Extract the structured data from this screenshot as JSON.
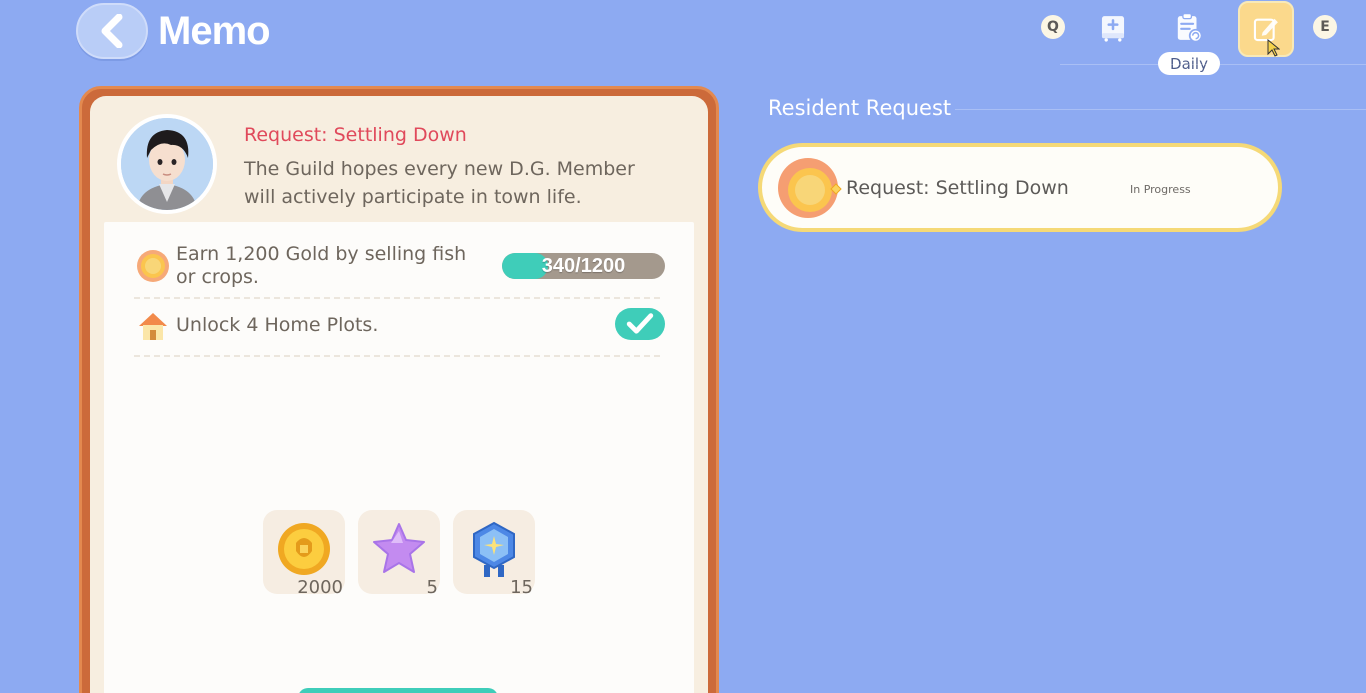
{
  "header": {
    "title": "Memo",
    "key_left": "Q",
    "key_right": "E",
    "tooltip": "Daily"
  },
  "memo": {
    "request_title": "Request: Settling Down",
    "description": "The Guild hopes every new D.G. Member will actively participate in town life.",
    "objectives": [
      {
        "text": "Earn 1,200 Gold by selling fish or crops.",
        "icon": "gold-coin-icon",
        "progress_text": "340/1200",
        "progress_fraction": 0.283
      },
      {
        "text": "Unlock 4 Home Plots.",
        "icon": "house-icon",
        "completed": true
      }
    ],
    "rewards": [
      {
        "icon": "gold-coin-icon",
        "count": "2000"
      },
      {
        "icon": "purple-star-icon",
        "count": "5"
      },
      {
        "icon": "blue-badge-icon",
        "count": "15"
      }
    ]
  },
  "resident": {
    "section_title": "Resident Request",
    "items": [
      {
        "label": "Request: Settling Down",
        "status": "In Progress",
        "icon": "gold-coin-icon"
      }
    ]
  },
  "colors": {
    "background": "#8daaf2",
    "frame": "#cc6a3a",
    "accent_teal": "#3fcdb9",
    "request_red": "#e0495b",
    "highlight_yellow": "#f5d977"
  }
}
